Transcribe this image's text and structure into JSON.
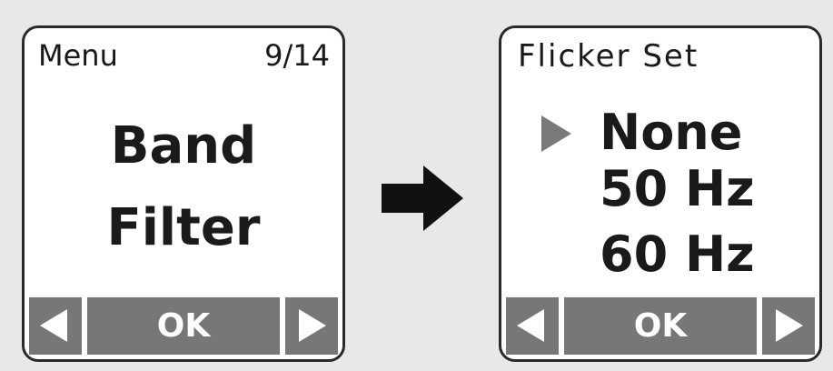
{
  "left_screen": {
    "header_left": "Menu",
    "header_right": "9/14",
    "item_line1": "Band",
    "item_line2": "Filter",
    "buttons": {
      "prev_icon": "left-triangle-icon",
      "ok": "OK",
      "next_icon": "right-triangle-icon"
    }
  },
  "right_screen": {
    "title": "Flicker Set",
    "options": [
      "None",
      "50 Hz",
      "60 Hz"
    ],
    "selected_index": 0,
    "cursor_icon": "pointer-triangle-icon",
    "buttons": {
      "prev_icon": "left-triangle-icon",
      "ok": "OK",
      "next_icon": "right-triangle-icon"
    }
  },
  "transition_icon": "right-arrow-icon",
  "colors": {
    "background": "#e8e8e8",
    "screen": "#ffffff",
    "border": "#2a2a2a",
    "button": "#777777",
    "cursor": "#7a7a7a",
    "text": "#1a1a1a"
  }
}
